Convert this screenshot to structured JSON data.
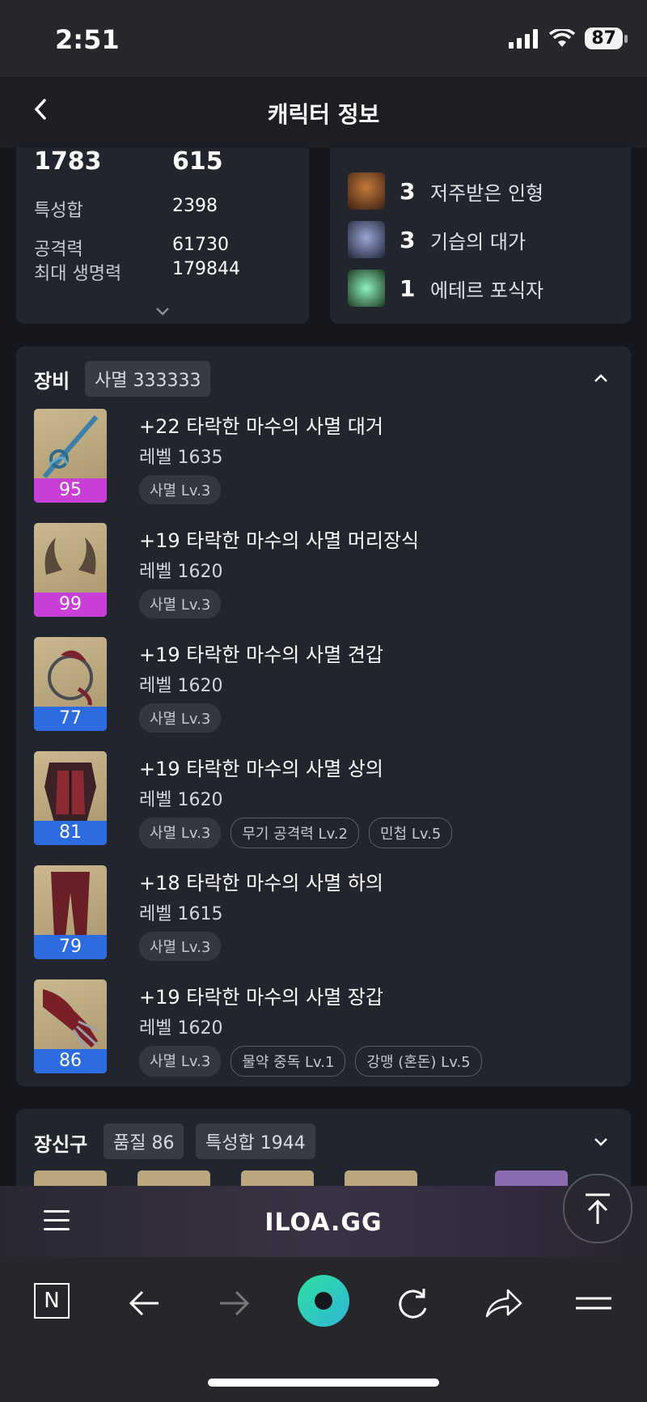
{
  "status": {
    "time": "2:51",
    "battery": "87"
  },
  "header": {
    "title": "캐릭터 정보"
  },
  "stats": {
    "big_left": "1783",
    "big_right": "615",
    "rows": [
      {
        "label": "특성합",
        "value": "2398"
      },
      {
        "label": "공격력",
        "value": "61730"
      },
      {
        "label": "최대 생명력",
        "value": "179844"
      }
    ]
  },
  "engravings": [
    {
      "count": "3",
      "name": "저주받은 인형",
      "color": "#8a4a2a"
    },
    {
      "count": "3",
      "name": "기습의 대가",
      "color": "#4a5c8a"
    },
    {
      "count": "1",
      "name": "에테르 포식자",
      "color": "#3aa86a"
    }
  ],
  "equipment": {
    "title": "장비",
    "badge": "사멸 333333",
    "items": [
      {
        "name": "+22 타락한 마수의 사멸 대거",
        "level": "레벨 1635",
        "quality": "95",
        "tier": "purple",
        "tags": [
          {
            "text": "사멸 Lv.3",
            "style": "filled"
          }
        ]
      },
      {
        "name": "+19 타락한 마수의 사멸 머리장식",
        "level": "레벨 1620",
        "quality": "99",
        "tier": "purple",
        "tags": [
          {
            "text": "사멸 Lv.3",
            "style": "filled"
          }
        ]
      },
      {
        "name": "+19 타락한 마수의 사멸 견갑",
        "level": "레벨 1620",
        "quality": "77",
        "tier": "blue",
        "tags": [
          {
            "text": "사멸 Lv.3",
            "style": "filled"
          }
        ]
      },
      {
        "name": "+19 타락한 마수의 사멸 상의",
        "level": "레벨 1620",
        "quality": "81",
        "tier": "blue",
        "tags": [
          {
            "text": "사멸 Lv.3",
            "style": "filled"
          },
          {
            "text": "무기 공격력 Lv.2",
            "style": "outline"
          },
          {
            "text": "민첩 Lv.5",
            "style": "outline"
          }
        ]
      },
      {
        "name": "+18 타락한 마수의 사멸 하의",
        "level": "레벨 1615",
        "quality": "79",
        "tier": "blue",
        "tags": [
          {
            "text": "사멸 Lv.3",
            "style": "filled"
          }
        ]
      },
      {
        "name": "+19 타락한 마수의 사멸 장갑",
        "level": "레벨 1620",
        "quality": "86",
        "tier": "blue",
        "tags": [
          {
            "text": "사멸 Lv.3",
            "style": "filled"
          },
          {
            "text": "물약 중독 Lv.1",
            "style": "outline"
          },
          {
            "text": "강맹 (혼돈) Lv.5",
            "style": "outline"
          }
        ]
      }
    ]
  },
  "accessories": {
    "title": "장신구",
    "badge_quality": "품질 86",
    "badge_stat": "특성합 1944"
  },
  "site": {
    "brand": "ILOA.GG"
  },
  "browser": {
    "tab_letter": "N"
  }
}
